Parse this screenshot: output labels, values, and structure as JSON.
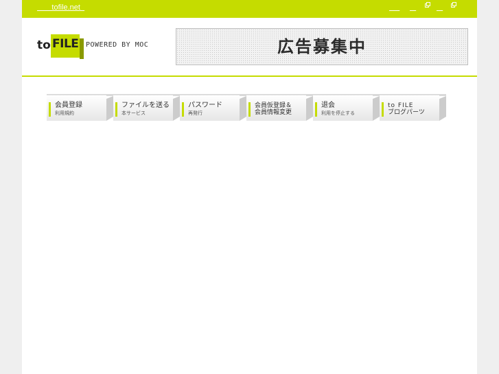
{
  "topbar": {
    "left_link": "       tofile.net  ",
    "right_links": [
      "     ",
      "   ",
      "   "
    ]
  },
  "logo": {
    "to": "to",
    "file": "FILE",
    "powered": "POWERED BY MOC"
  },
  "ad": {
    "text": "広告募集中"
  },
  "nav": {
    "items": [
      {
        "title": "会員登録",
        "sub": "利用規約"
      },
      {
        "title": "ファイルを送る",
        "sub": "本サービス"
      },
      {
        "title": "パスワード",
        "sub": "再発行"
      },
      {
        "title": "会員仮登録＆",
        "title2": "会員情報変更"
      },
      {
        "title": "退会",
        "sub": "利用を停止する"
      },
      {
        "title": "to FILE",
        "title2": "ブログパーツ"
      }
    ]
  },
  "colors": {
    "accent": "#c5dc00",
    "background": "#efefef"
  }
}
